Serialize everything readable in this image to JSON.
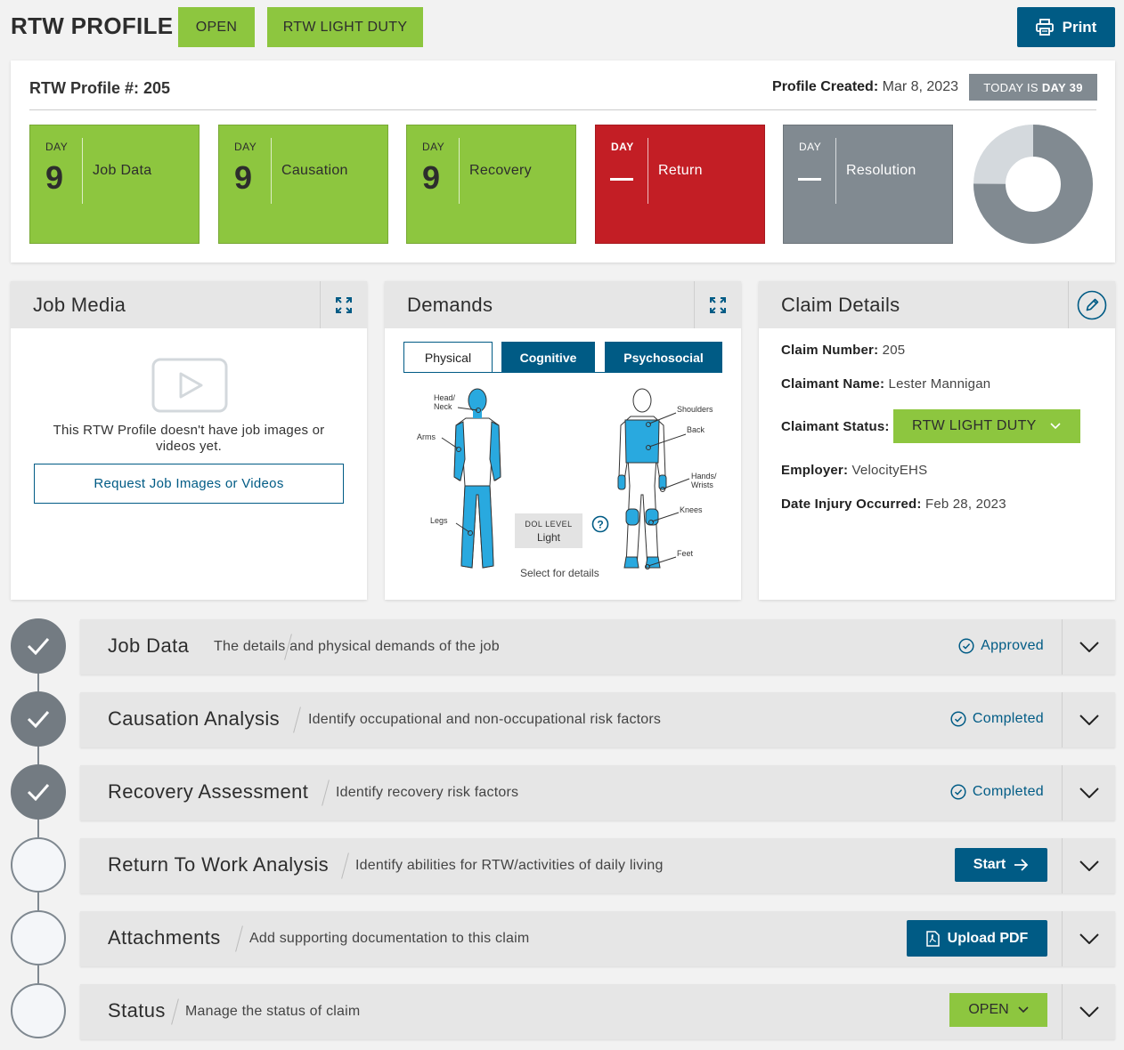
{
  "header": {
    "title": "RTW PROFILE",
    "tag_open": "OPEN",
    "tag_status": "RTW LIGHT DUTY",
    "print_label": "Print"
  },
  "profile": {
    "number_label": "RTW Profile #:",
    "number": "205",
    "created_label": "Profile Created:",
    "created_date": "Mar 8, 2023",
    "today_prefix": "TODAY IS",
    "today_day": "DAY 39"
  },
  "tiles": [
    {
      "day_label": "DAY",
      "day": "9",
      "label": "Job Data",
      "color": "#8dc63f"
    },
    {
      "day_label": "DAY",
      "day": "9",
      "label": "Causation",
      "color": "#8dc63f"
    },
    {
      "day_label": "DAY",
      "day": "9",
      "label": "Recovery",
      "color": "#8dc63f"
    },
    {
      "day_label": "DAY",
      "day": "",
      "label": "Return",
      "color": "#c31e25"
    },
    {
      "day_label": "DAY",
      "day": "",
      "label": "Resolution",
      "color": "#818a91"
    }
  ],
  "donut": {
    "completed_fraction": 0.75
  },
  "job_media": {
    "title": "Job Media",
    "empty_text": "This RTW Profile doesn't have job images or videos yet.",
    "request_button": "Request Job Images or Videos"
  },
  "demands": {
    "title": "Demands",
    "tabs": [
      "Physical",
      "Cognitive",
      "Psychosocial"
    ],
    "labels": {
      "head": "Head/\nNeck",
      "arms": "Arms",
      "legs": "Legs",
      "shoulders": "Shoulders",
      "back": "Back",
      "hands": "Hands/\nWrists",
      "knees": "Knees",
      "feet": "Feet"
    },
    "dol_label": "DOL LEVEL",
    "dol_value": "Light",
    "select_hint": "Select for details"
  },
  "claim": {
    "title": "Claim Details",
    "number_label": "Claim Number:",
    "number": "205",
    "name_label": "Claimant Name:",
    "name": "Lester Mannigan",
    "status_label": "Claimant Status:",
    "status": "RTW LIGHT DUTY",
    "employer_label": "Employer:",
    "employer": "VelocityEHS",
    "injury_label": "Date Injury Occurred:",
    "injury_date": "Feb 28, 2023"
  },
  "steps": [
    {
      "title": "Job Data",
      "subtitle": "The details and physical demands of the job",
      "status": "Approved"
    },
    {
      "title": "Causation Analysis",
      "subtitle": "Identify occupational and non-occupational risk factors",
      "status": "Completed"
    },
    {
      "title": "Recovery Assessment",
      "subtitle": "Identify recovery risk factors",
      "status": "Completed"
    },
    {
      "title": "Return To Work Analysis",
      "subtitle": "Identify abilities for RTW/activities of daily living",
      "action": "Start"
    },
    {
      "title": "Attachments",
      "subtitle": "Add supporting documentation to this claim",
      "action": "Upload PDF"
    },
    {
      "title": "Status",
      "subtitle": "Manage the status of claim",
      "action": "OPEN"
    }
  ],
  "colors": {
    "green": "#8dc63f",
    "blue": "#005b85",
    "red": "#c31e25",
    "gray": "#818a91",
    "body_blue": "#29a9df"
  }
}
